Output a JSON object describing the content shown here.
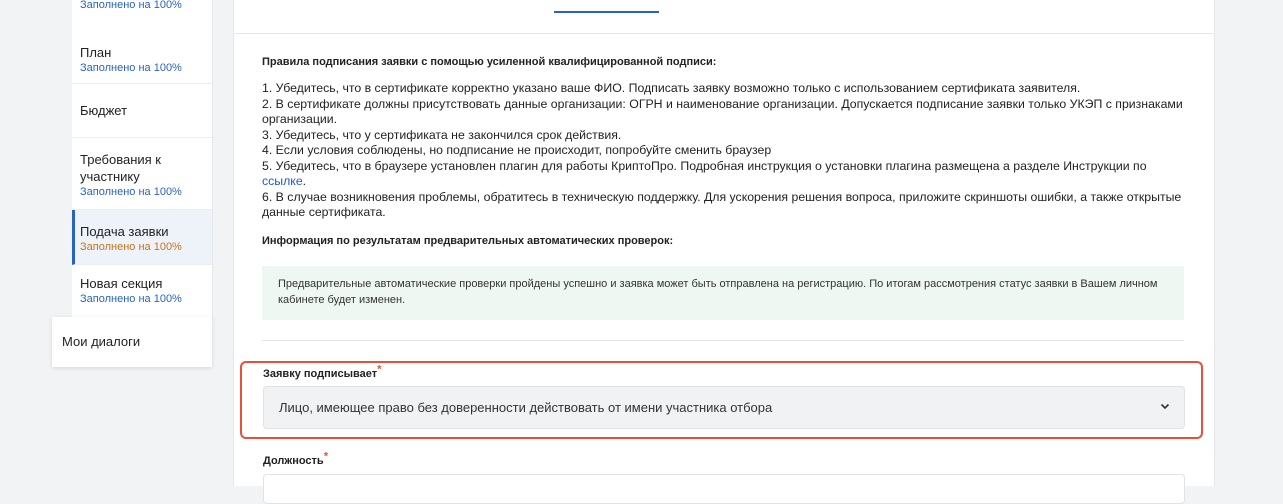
{
  "sidebar": {
    "top_status": "Заполнено на 100%",
    "items": [
      {
        "label": "План",
        "status": "Заполнено на 100%"
      },
      {
        "label": "Бюджет",
        "status": ""
      },
      {
        "label": "Требования к участнику",
        "status": "Заполнено на 100%"
      },
      {
        "label": "Подача заявки",
        "status": "Заполнено на 100%"
      },
      {
        "label": "Новая секция",
        "status": "Заполнено на 100%"
      }
    ],
    "dialogs": "Мои диалоги"
  },
  "rules": {
    "title": "Правила подписания заявки с помощью усиленной квалифицированной подписи:",
    "r1": "1. Убедитесь, что в сертификате корректно указано ваше ФИО. Подписать заявку возможно только с использованием сертификата заявителя.",
    "r2": "2. В сертификате должны присутствовать данные организации: ОГРН и наименование организации. Допускается подписание заявки только УКЭП с признаками организации.",
    "r3": "3. Убедитесь, что у сертификата не закончился срок действия.",
    "r4": "4. Если условия соблюдены, но подписание не происходит, попробуйте сменить браузер",
    "r5_text": "5. Убедитесь, что в браузере установлен плагин для работы КриптоПро. Подробная инструкция о установки плагина размещена а разделе Инструкции по",
    "r5_link": "ссылке",
    "r5_end": ".",
    "r6": "6. В случае возникновения проблемы, обратитесь в техническую поддержку. Для ускорения решения вопроса, приложите скриншоты ошибки, а также открытые данные сертификата."
  },
  "checks": {
    "title": "Информация по результатам предварительных автоматических проверок:",
    "message": "Предварительные автоматические проверки пройдены успешно и заявка может быть отправлена на регистрацию. По итогам рассмотрения статус заявки в Вашем личном кабинете будет изменен."
  },
  "signer": {
    "label": "Заявку подписывает",
    "required_mark": "*",
    "value": "Лицо, имеющее право без доверенности действовать от имени участника отбора",
    "icon": "chevron-down-icon"
  },
  "position": {
    "label": "Должность",
    "required_mark": "*"
  },
  "colors": {
    "accent": "#2a62c4",
    "highlight": "#e8503a",
    "success_bg": "#eef7f2",
    "active_status": "#c6741f"
  }
}
